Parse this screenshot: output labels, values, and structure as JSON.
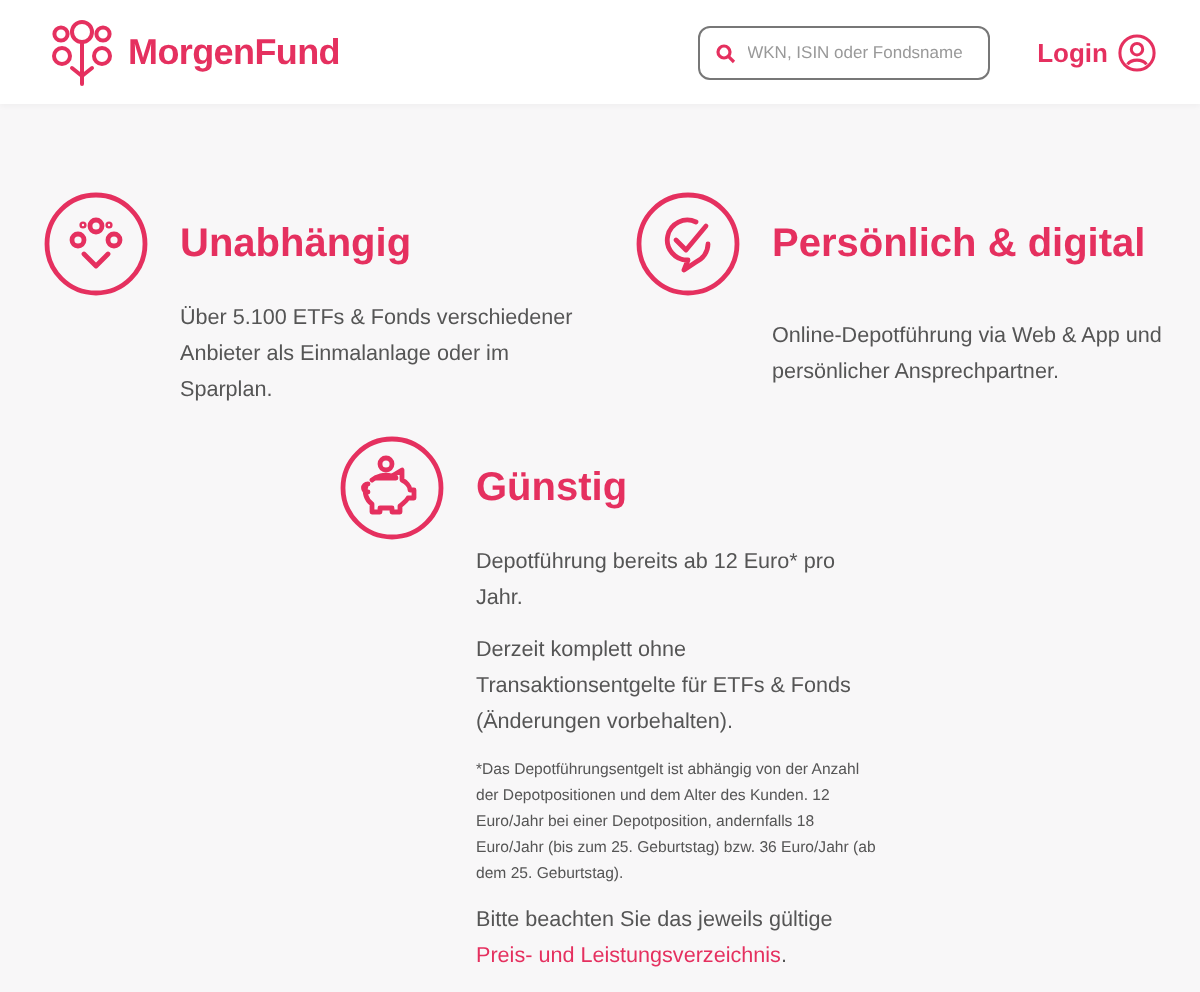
{
  "header": {
    "brand": "MorgenFund",
    "search": {
      "placeholder": "WKN, ISIN oder Fondsname"
    },
    "login": "Login"
  },
  "features": [
    {
      "kind": "people",
      "title": "Unabhängig",
      "paragraphs": [
        {
          "kind": "text",
          "text": "Über 5.100 ETFs & Fonds verschiedener Anbieter als Einmalanlage oder im Sparplan."
        }
      ]
    },
    {
      "kind": "chat-check",
      "title": "Persönlich & digital",
      "paragraphs": [
        {
          "kind": "text",
          "text": "Online-Depotführung via Web & App und persönlicher Ansprechpartner."
        }
      ]
    },
    {
      "kind": "piggy",
      "title": "Günstig",
      "paragraphs": [
        {
          "kind": "text",
          "text": "Depotführung bereits ab 12 Euro* pro Jahr."
        },
        {
          "kind": "text",
          "text": "Derzeit komplett ohne Transaktionsentgelte für ETFs & Fonds (Änderungen vorbehalten)."
        },
        {
          "kind": "note",
          "text": "*Das Depotführungsentgelt ist abhängig von der Anzahl der Depotpositionen und dem Alter des Kunden. 12 Euro/Jahr bei einer Depotposition, andernfalls 18 Euro/Jahr (bis zum 25. Geburtstag) bzw. 36 Euro/Jahr (ab dem 25. Geburtstag)."
        },
        {
          "kind": "link",
          "text": "Bitte beachten Sie das jeweils gültige",
          "link": "Preis- und Leistungsverzeichnis",
          "after": "."
        }
      ]
    }
  ]
}
